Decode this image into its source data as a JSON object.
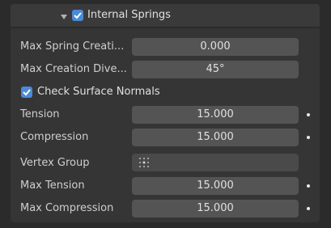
{
  "panel": {
    "title": "Internal Springs",
    "enabled": true
  },
  "rows": [
    {
      "label": "Max Spring Creati...",
      "value": "0.000"
    },
    {
      "label": "Max Creation Dive...",
      "value": "45°"
    }
  ],
  "check_surface_normals": {
    "label": "Check Surface Normals",
    "checked": true
  },
  "params": [
    {
      "label": "Tension",
      "value": "15.000"
    },
    {
      "label": "Compression",
      "value": "15.000"
    },
    {
      "label": "Vertex Group",
      "value": ""
    },
    {
      "label": "Max Tension",
      "value": "15.000"
    },
    {
      "label": "Max Compression",
      "value": "15.000"
    }
  ],
  "colors": {
    "accent": "#4b8ad6",
    "field": "#545454",
    "panel_bg": "#353535"
  },
  "icons": {
    "vertex_group": "vertex-group-icon",
    "animate": "dot-icon",
    "collapse": "triangle-down-icon"
  }
}
